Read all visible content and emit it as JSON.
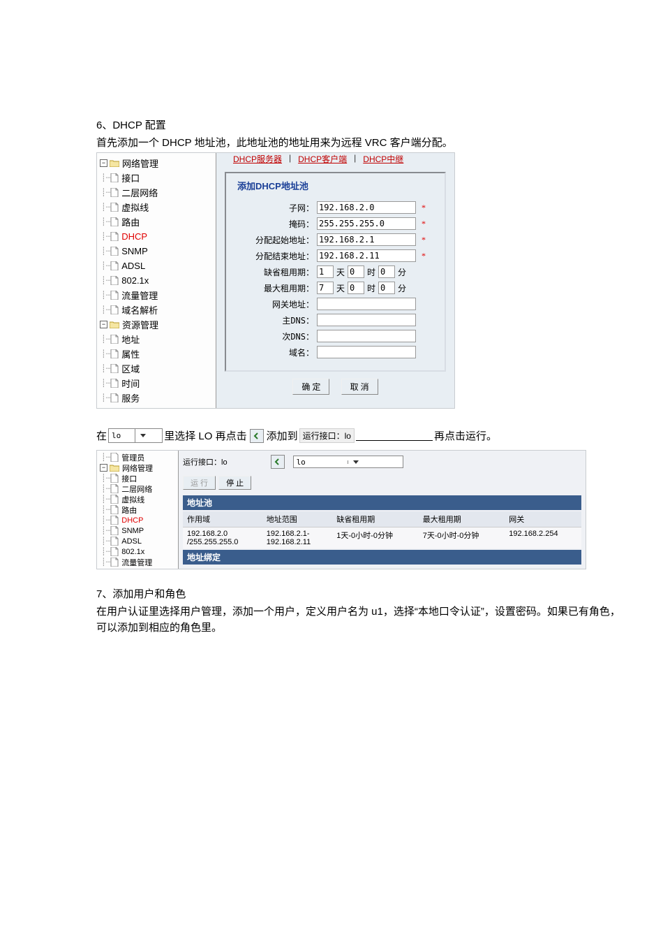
{
  "section1": {
    "title": "6、DHCP 配置",
    "intro": "首先添加一个 DHCP 地址池，此地址池的地址用来为远程 VRC 客户端分配。"
  },
  "tree1": {
    "root1": "网络管理",
    "items1": [
      "接口",
      "二层网络",
      "虚拟线",
      "路由",
      "DHCP",
      "SNMP",
      "ADSL",
      "802.1x",
      "流量管理",
      "域名解析"
    ],
    "root2": "资源管理",
    "items2": [
      "地址",
      "属性",
      "区域",
      "时间",
      "服务"
    ]
  },
  "tabs": {
    "t1": "DHCP服务器",
    "t2": "DHCP客户端",
    "t3": "DHCP中继",
    "sep": "|"
  },
  "form": {
    "title": "添加DHCP地址池",
    "labels": {
      "subnet": "子网：",
      "mask": "掩码：",
      "start": "分配起始地址：",
      "end": "分配结束地址：",
      "def_lease": "缺省租用期：",
      "max_lease": "最大租用期：",
      "gateway": "网关地址：",
      "dns1": "主DNS：",
      "dns2": "次DNS：",
      "domain": "域名："
    },
    "values": {
      "subnet": "192.168.2.0",
      "mask": "255.255.255.0",
      "start": "192.168.2.1",
      "end": "192.168.2.11",
      "def_d": "1",
      "def_h": "0",
      "def_m": "0",
      "max_d": "7",
      "max_h": "0",
      "max_m": "0",
      "gateway": "",
      "dns1": "",
      "dns2": "",
      "domain": ""
    },
    "units": {
      "day": "天",
      "hour": "时",
      "min": "分"
    },
    "req": "*",
    "ok": "确 定",
    "cancel": "取 消"
  },
  "inline": {
    "pre": "在",
    "combo": "lo",
    "mid1": "里选择 LO 再点击",
    "mid2": "添加到",
    "badge": "运行接口：lo",
    "tail": "再点击运行。"
  },
  "tree2": {
    "root_top_items": [
      "管理员"
    ],
    "root": "网络管理",
    "items": [
      "接口",
      "二层网络",
      "虚拟线",
      "路由",
      "DHCP",
      "SNMP",
      "ADSL",
      "802.1x",
      "流量管理"
    ]
  },
  "panel2": {
    "run_label": "运行接口：lo",
    "combo": "lo",
    "run": "运 行",
    "stop": "停 止",
    "bar1": "地址池",
    "table": {
      "headers": [
        "作用域",
        "地址范围",
        "缺省租用期",
        "最大租用期",
        "网关"
      ],
      "row": {
        "scope": "192.168.2.0\n/255.255.255.0",
        "range": "192.168.2.1-\n192.168.2.11",
        "def": "1天-0小时-0分钟",
        "max": "7天-0小时-0分钟",
        "gw": "192.168.2.254"
      }
    },
    "bar2": "地址绑定"
  },
  "section2": {
    "title": "7、添加用户和角色",
    "body": "在用户认证里选择用户管理，添加一个用户，定义用户名为 u1，选择“本地口令认证”，设置密码。如果已有角色，可以添加到相应的角色里。"
  }
}
